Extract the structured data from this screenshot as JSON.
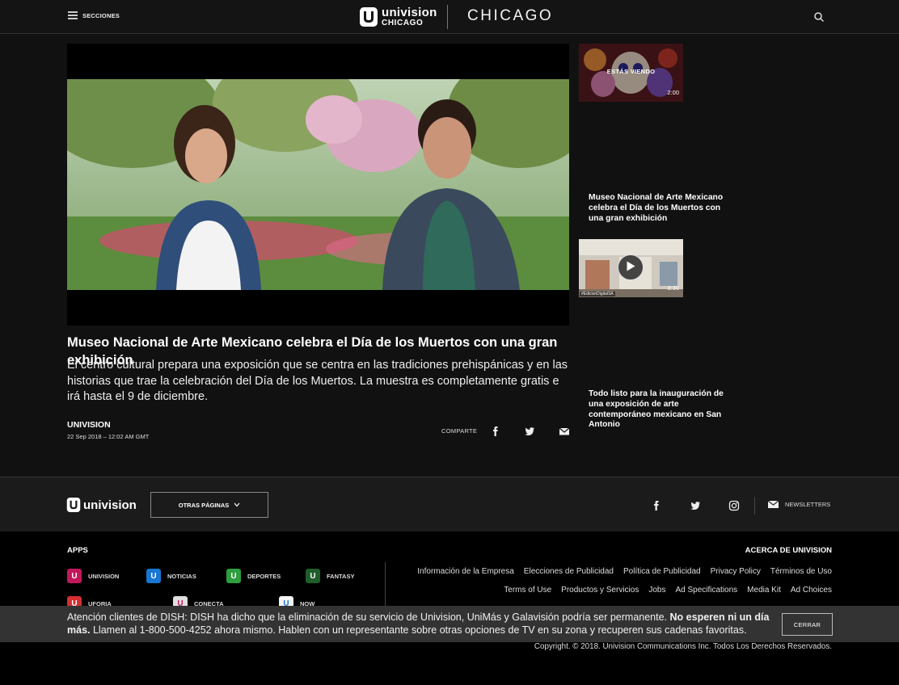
{
  "header": {
    "menu_label": "SECCIONES",
    "logo_name": "univision",
    "logo_city": "CHICAGO",
    "city_title": "CHICAGO"
  },
  "article": {
    "title": "Museo Nacional de Arte Mexicano celebra el Día de los Muertos con una gran exhibición",
    "description": "El centro cultural prepara una exposición que se centra en las tradiciones prehispánicas y en las historias que trae la celebración del Día de los Muertos. La muestra es completamente gratis e irá hasta el 9 de diciembre.",
    "author": "UNIVISION",
    "date": "22 Sep 2018 – 12:02 AM GMT",
    "share_label": "COMPARTE"
  },
  "playlist": [
    {
      "watching_label": "ESTÁS VIENDO",
      "duration": "2:00",
      "title": "Museo Nacional de Arte Mexicano celebra el Día de los Muertos con una gran exhibición"
    },
    {
      "duration": "3:30",
      "tag": "#EdicionDigitalSA",
      "title": "Todo listo para la inauguración de una exposición de arte contemporáneo mexicano en San Antonio"
    }
  ],
  "footer": {
    "logo_name": "univision",
    "other_pages_label": "OTRAS PÁGINAS",
    "newsletters_label": "NEWSLETTERS"
  },
  "bottom": {
    "apps_heading": "APPS",
    "about_heading": "ACERCA DE UNIVISION",
    "apps": [
      {
        "label": "UNIVISION",
        "color": "#c2185b"
      },
      {
        "label": "NOTICIAS",
        "color": "#1976d2"
      },
      {
        "label": "DEPORTES",
        "color": "#2e9e3e"
      },
      {
        "label": "FANTASY",
        "color": "#1f5e2a"
      },
      {
        "label": "UFORIA",
        "color": "#d32f2f"
      },
      {
        "label": "CONECTA",
        "color": "#e0e0e0"
      },
      {
        "label": "NOW",
        "color": "#f5f5f5"
      }
    ],
    "links_row1": [
      "Información de la Empresa",
      "Elecciones de Publicidad",
      "Política de Publicidad",
      "Privacy Policy",
      "Términos de Uso"
    ],
    "links_row2": [
      "Terms of Use",
      "Productos y Servicios",
      "Jobs",
      "Ad Specifications",
      "Media Kit",
      "Ad Choices"
    ],
    "copyright": "Copyright. © 2018. Univision Communications Inc. Todos Los Derechos Reservados."
  },
  "alert": {
    "text_part1": "Atención clientes de DISH: DISH ha dicho que la eliminación de su servicio de Univision, UniMás y Galavisión podría ser permanente.",
    "text_bold": "No esperen ni un día más.",
    "text_part2": "Llamen al 1-800-500-4252 ahora mismo. Hablen con un representante sobre otras opciones de TV en su zona y recuperen sus cadenas favoritas.",
    "close_label": "CERRAR"
  }
}
